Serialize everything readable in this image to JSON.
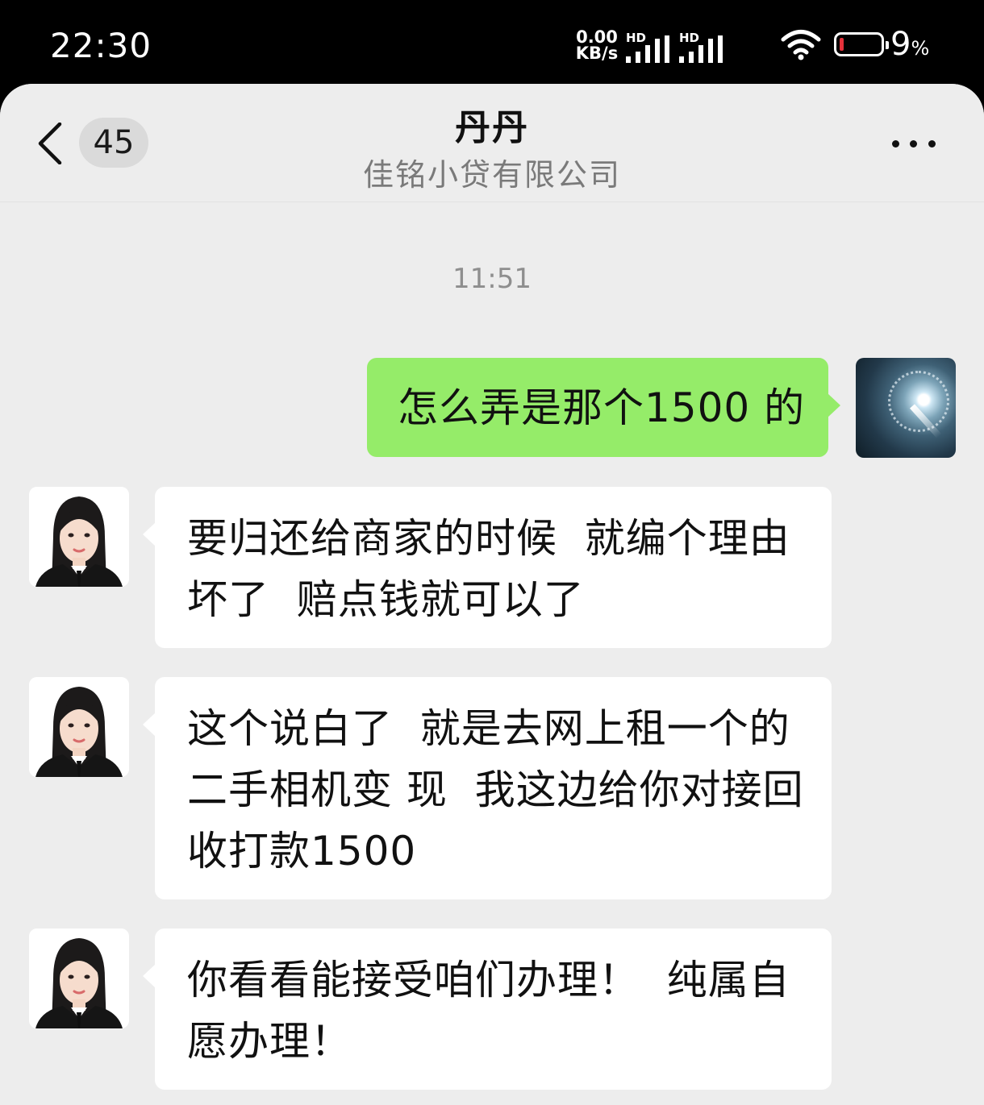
{
  "status_bar": {
    "time": "22:30",
    "net_speed_value": "0.00",
    "net_speed_unit": "KB/s",
    "signal_labels": [
      "HD",
      "HD"
    ],
    "battery_percent": "9",
    "battery_percent_sign": "%"
  },
  "header": {
    "back_icon": "chevron-left-icon",
    "unread_count": "45",
    "title": "丹丹",
    "subtitle": "佳铭小贷有限公司",
    "more_icon": "more-dots-icon"
  },
  "chat": {
    "timestamp": "11:51",
    "messages": [
      {
        "side": "sent",
        "text": "怎么弄是那个1500 的"
      },
      {
        "side": "received",
        "text": "要归还给商家的时候  就编个理由\n坏了  赔点钱就可以了"
      },
      {
        "side": "received",
        "text": "这个说白了  就是去网上租一个的\n二手相机变 现  我这边给你对接回\n收打款1500"
      },
      {
        "side": "received",
        "text": "你看看能接受咱们办理！  纯属自\n愿办理！"
      }
    ]
  },
  "colors": {
    "sent_bubble": "#95ec69",
    "received_bubble": "#ffffff",
    "chat_background": "#ededed",
    "battery_low": "#e5313a"
  }
}
